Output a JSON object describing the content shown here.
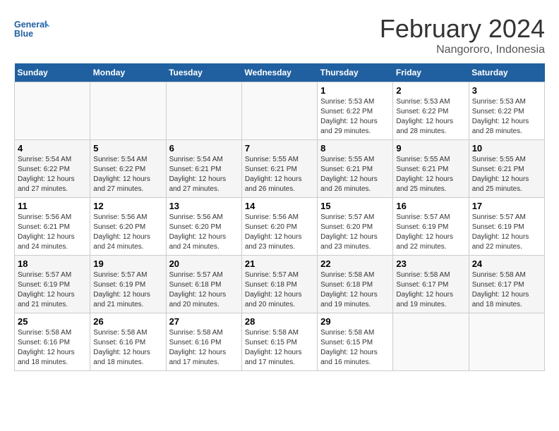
{
  "header": {
    "logo_line1": "General",
    "logo_line2": "Blue",
    "month": "February 2024",
    "location": "Nangororo, Indonesia"
  },
  "weekdays": [
    "Sunday",
    "Monday",
    "Tuesday",
    "Wednesday",
    "Thursday",
    "Friday",
    "Saturday"
  ],
  "weeks": [
    [
      {
        "day": "",
        "info": ""
      },
      {
        "day": "",
        "info": ""
      },
      {
        "day": "",
        "info": ""
      },
      {
        "day": "",
        "info": ""
      },
      {
        "day": "1",
        "info": "Sunrise: 5:53 AM\nSunset: 6:22 PM\nDaylight: 12 hours\nand 29 minutes."
      },
      {
        "day": "2",
        "info": "Sunrise: 5:53 AM\nSunset: 6:22 PM\nDaylight: 12 hours\nand 28 minutes."
      },
      {
        "day": "3",
        "info": "Sunrise: 5:53 AM\nSunset: 6:22 PM\nDaylight: 12 hours\nand 28 minutes."
      }
    ],
    [
      {
        "day": "4",
        "info": "Sunrise: 5:54 AM\nSunset: 6:22 PM\nDaylight: 12 hours\nand 27 minutes."
      },
      {
        "day": "5",
        "info": "Sunrise: 5:54 AM\nSunset: 6:22 PM\nDaylight: 12 hours\nand 27 minutes."
      },
      {
        "day": "6",
        "info": "Sunrise: 5:54 AM\nSunset: 6:21 PM\nDaylight: 12 hours\nand 27 minutes."
      },
      {
        "day": "7",
        "info": "Sunrise: 5:55 AM\nSunset: 6:21 PM\nDaylight: 12 hours\nand 26 minutes."
      },
      {
        "day": "8",
        "info": "Sunrise: 5:55 AM\nSunset: 6:21 PM\nDaylight: 12 hours\nand 26 minutes."
      },
      {
        "day": "9",
        "info": "Sunrise: 5:55 AM\nSunset: 6:21 PM\nDaylight: 12 hours\nand 25 minutes."
      },
      {
        "day": "10",
        "info": "Sunrise: 5:55 AM\nSunset: 6:21 PM\nDaylight: 12 hours\nand 25 minutes."
      }
    ],
    [
      {
        "day": "11",
        "info": "Sunrise: 5:56 AM\nSunset: 6:21 PM\nDaylight: 12 hours\nand 24 minutes."
      },
      {
        "day": "12",
        "info": "Sunrise: 5:56 AM\nSunset: 6:20 PM\nDaylight: 12 hours\nand 24 minutes."
      },
      {
        "day": "13",
        "info": "Sunrise: 5:56 AM\nSunset: 6:20 PM\nDaylight: 12 hours\nand 24 minutes."
      },
      {
        "day": "14",
        "info": "Sunrise: 5:56 AM\nSunset: 6:20 PM\nDaylight: 12 hours\nand 23 minutes."
      },
      {
        "day": "15",
        "info": "Sunrise: 5:57 AM\nSunset: 6:20 PM\nDaylight: 12 hours\nand 23 minutes."
      },
      {
        "day": "16",
        "info": "Sunrise: 5:57 AM\nSunset: 6:19 PM\nDaylight: 12 hours\nand 22 minutes."
      },
      {
        "day": "17",
        "info": "Sunrise: 5:57 AM\nSunset: 6:19 PM\nDaylight: 12 hours\nand 22 minutes."
      }
    ],
    [
      {
        "day": "18",
        "info": "Sunrise: 5:57 AM\nSunset: 6:19 PM\nDaylight: 12 hours\nand 21 minutes."
      },
      {
        "day": "19",
        "info": "Sunrise: 5:57 AM\nSunset: 6:19 PM\nDaylight: 12 hours\nand 21 minutes."
      },
      {
        "day": "20",
        "info": "Sunrise: 5:57 AM\nSunset: 6:18 PM\nDaylight: 12 hours\nand 20 minutes."
      },
      {
        "day": "21",
        "info": "Sunrise: 5:57 AM\nSunset: 6:18 PM\nDaylight: 12 hours\nand 20 minutes."
      },
      {
        "day": "22",
        "info": "Sunrise: 5:58 AM\nSunset: 6:18 PM\nDaylight: 12 hours\nand 19 minutes."
      },
      {
        "day": "23",
        "info": "Sunrise: 5:58 AM\nSunset: 6:17 PM\nDaylight: 12 hours\nand 19 minutes."
      },
      {
        "day": "24",
        "info": "Sunrise: 5:58 AM\nSunset: 6:17 PM\nDaylight: 12 hours\nand 18 minutes."
      }
    ],
    [
      {
        "day": "25",
        "info": "Sunrise: 5:58 AM\nSunset: 6:16 PM\nDaylight: 12 hours\nand 18 minutes."
      },
      {
        "day": "26",
        "info": "Sunrise: 5:58 AM\nSunset: 6:16 PM\nDaylight: 12 hours\nand 18 minutes."
      },
      {
        "day": "27",
        "info": "Sunrise: 5:58 AM\nSunset: 6:16 PM\nDaylight: 12 hours\nand 17 minutes."
      },
      {
        "day": "28",
        "info": "Sunrise: 5:58 AM\nSunset: 6:15 PM\nDaylight: 12 hours\nand 17 minutes."
      },
      {
        "day": "29",
        "info": "Sunrise: 5:58 AM\nSunset: 6:15 PM\nDaylight: 12 hours\nand 16 minutes."
      },
      {
        "day": "",
        "info": ""
      },
      {
        "day": "",
        "info": ""
      }
    ]
  ]
}
